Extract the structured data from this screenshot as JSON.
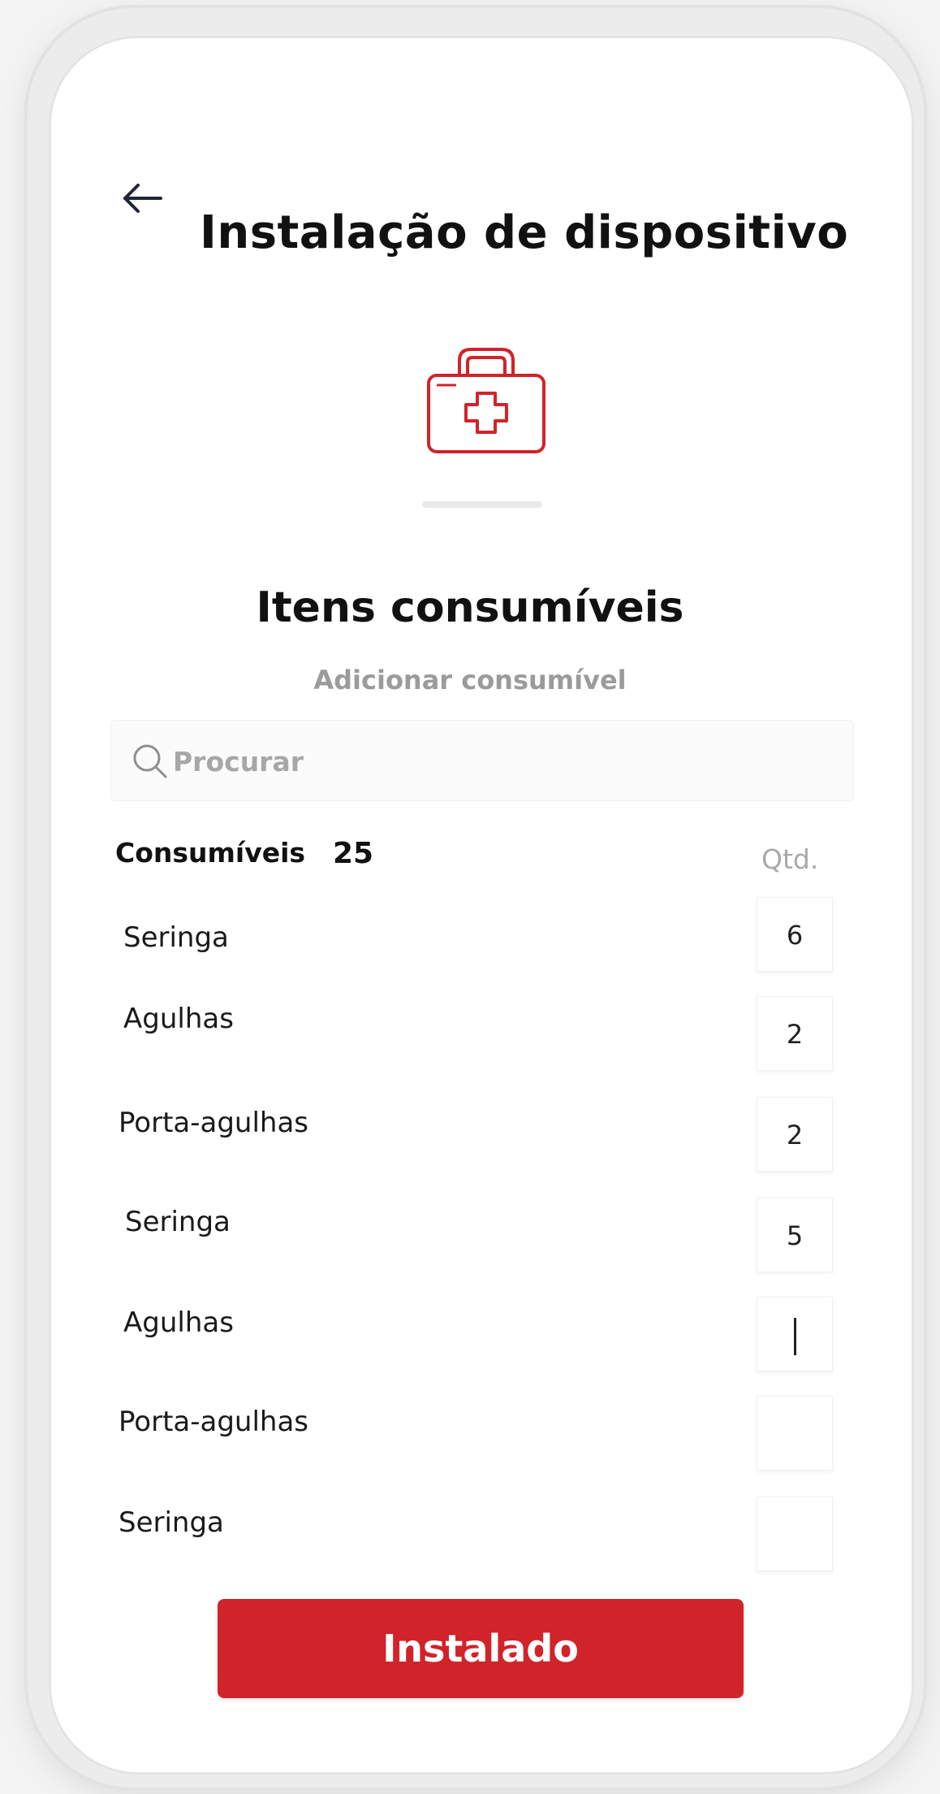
{
  "header": {
    "back_icon": "arrow-left-icon",
    "title": "Instalação de dispositivo"
  },
  "hero": {
    "icon": "first-aid-kit-icon",
    "accent_color": "#d1232a"
  },
  "section": {
    "title": "Itens consumíveis",
    "add_link": "Adicionar consumível"
  },
  "search": {
    "icon": "search-icon",
    "placeholder": "Procurar",
    "value": ""
  },
  "list": {
    "header_label": "Consumíveis",
    "count": "25",
    "qty_header": "Qtd.",
    "items": [
      {
        "name": "Seringa",
        "qty": "6"
      },
      {
        "name": "Agulhas",
        "qty": "2"
      },
      {
        "name": "Porta-agulhas",
        "qty": "2"
      },
      {
        "name": "Seringa",
        "qty": "5"
      },
      {
        "name": "Agulhas",
        "qty": "",
        "focused": true
      },
      {
        "name": "Porta-agulhas",
        "qty": ""
      },
      {
        "name": "Seringa",
        "qty": ""
      }
    ]
  },
  "actions": {
    "primary_label": "Instalado",
    "primary_color": "#d1232a"
  }
}
